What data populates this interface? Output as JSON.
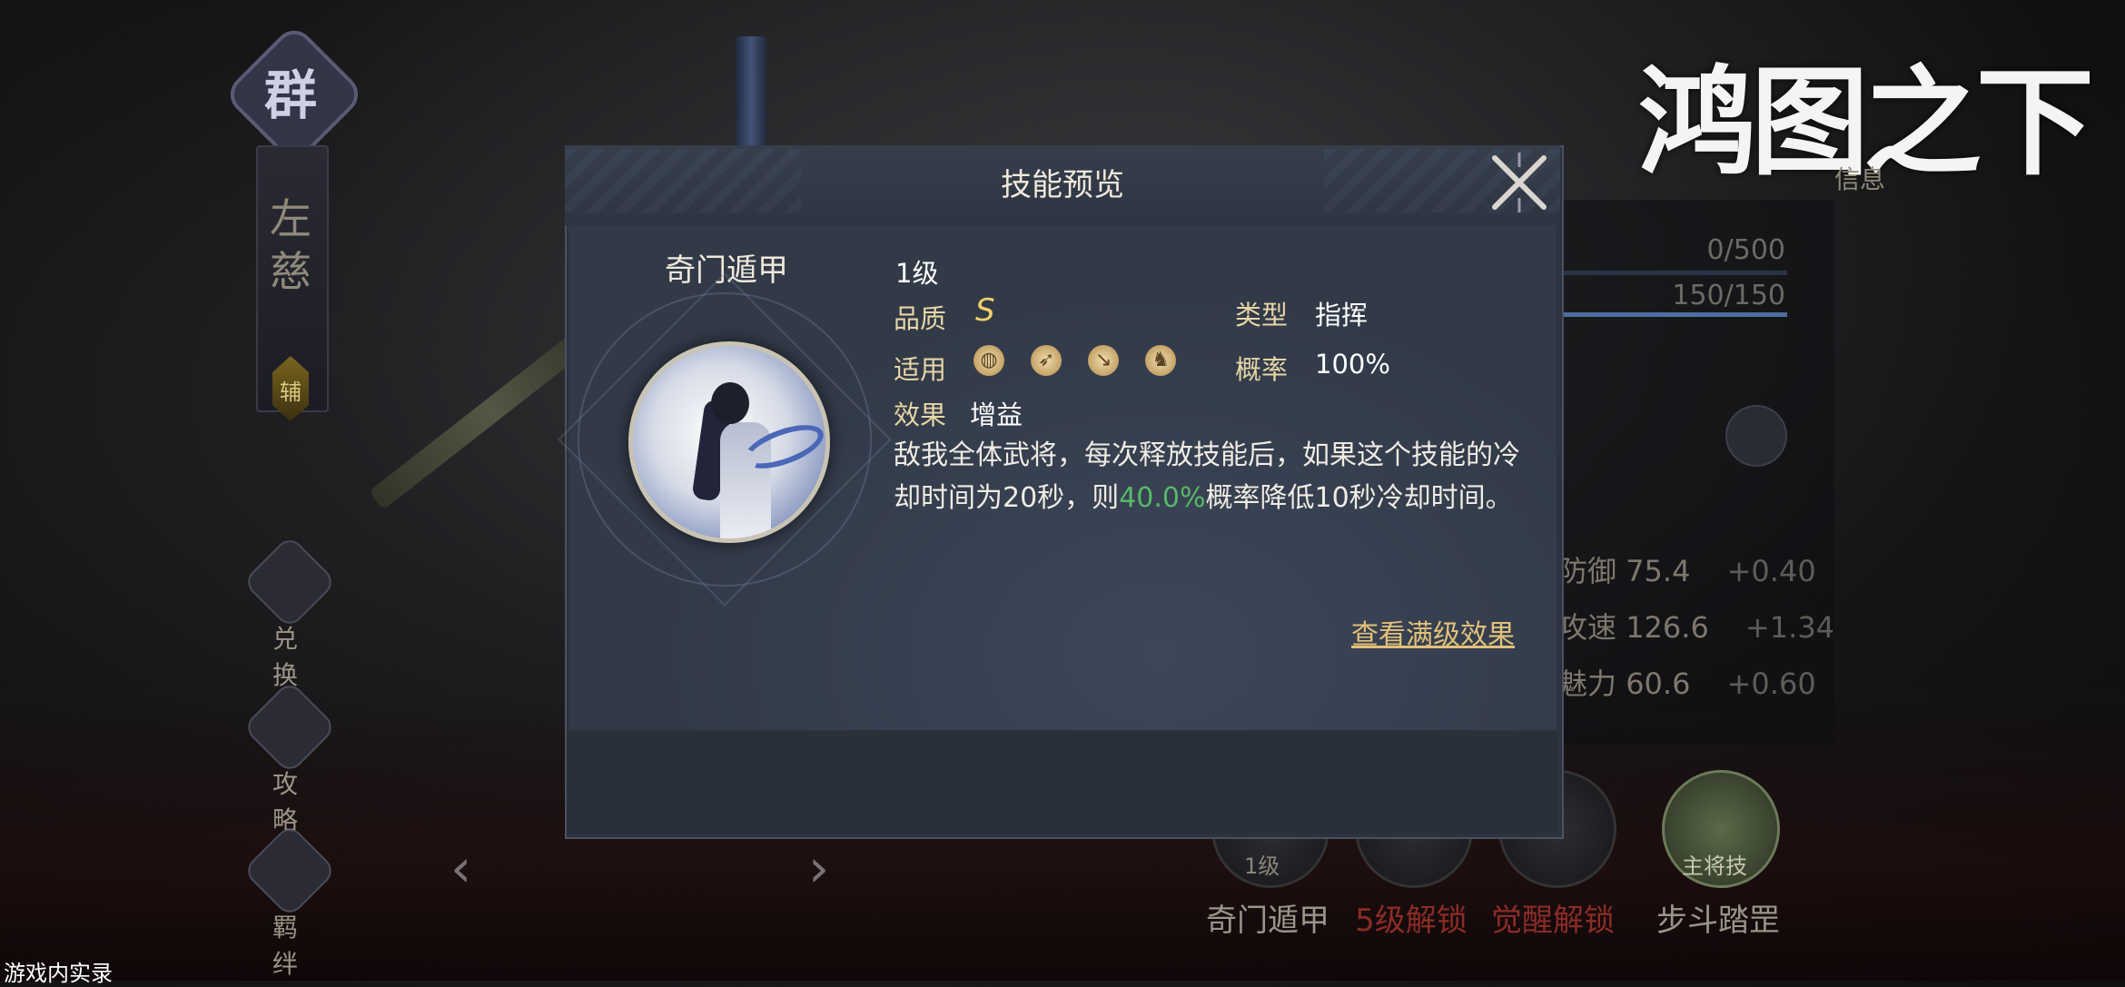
{
  "background": {
    "hero": {
      "faction": "群",
      "name_chars": [
        "左",
        "慈"
      ],
      "role": "辅"
    },
    "side_buttons": [
      {
        "icon": "exchange-icon",
        "label": "兑 换"
      },
      {
        "icon": "scroll-icon",
        "label": "攻 略"
      },
      {
        "icon": "bond-icon",
        "label": "羁 绊"
      }
    ],
    "logo_text": "鸿图之下",
    "info_tab": "信息",
    "bars": [
      {
        "text": "0/500",
        "fill": 0.0
      },
      {
        "text": "150/150",
        "fill": 1.0
      }
    ],
    "stats": [
      {
        "name": "防御",
        "value": "75.4",
        "bonus": "+0.40"
      },
      {
        "name": "攻速",
        "value": "126.6",
        "bonus": "+1.34"
      },
      {
        "name": "魅力",
        "value": "60.6",
        "bonus": "+0.60"
      }
    ],
    "skill_strip": [
      {
        "name": "奇门遁甲",
        "badge": "1级",
        "color": "#9a948a"
      },
      {
        "name": "5级解锁",
        "badge": "",
        "color": "#8a2c26"
      },
      {
        "name": "觉醒解锁",
        "badge": "",
        "color": "#8a2c26"
      },
      {
        "name": "步斗踏罡",
        "badge": "主将技",
        "color": "#9a948a"
      }
    ],
    "footer_tag": "游戏内实录"
  },
  "modal": {
    "title": "技能预览",
    "skill_name": "奇门遁甲",
    "level": "1级",
    "quality_label": "品质",
    "quality_value": "S",
    "type_label": "类型",
    "type_value": "指挥",
    "apply_label": "适用",
    "apply_icons": [
      "shield-icon",
      "bow-icon",
      "spear-icon",
      "cavalry-icon"
    ],
    "rate_label": "概率",
    "rate_value": "100%",
    "effect_label": "效果",
    "effect_value": "增益",
    "desc_before": "敌我全体武将，每次释放技能后，如果这个技能的冷却时间为20秒，则",
    "desc_highlight": "40.0%",
    "desc_after": "概率降低10秒冷却时间。",
    "full_effect_link": "查看满级效果",
    "colors": {
      "highlight": "#57b86a",
      "link": "#e1c17a",
      "label": "#e6d6a6"
    }
  }
}
